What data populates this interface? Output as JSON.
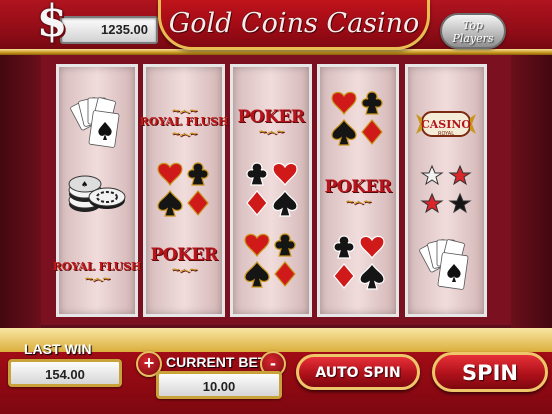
{
  "header": {
    "currency_symbol": "$",
    "balance": "1235.00",
    "title": "Gold Coins Casino",
    "top_players_line1": "Top",
    "top_players_line2": "Players"
  },
  "reels": {
    "poker_text": "POKER",
    "royal_flush_text": "ROYAL FLUSH",
    "casino_badge_text": "CASINO",
    "casino_badge_sub": "ROYAL",
    "columns": [
      [
        "cards-spade-hand-icon",
        "chips-stack-icon",
        "royal-flush-logo"
      ],
      [
        "royal-flush-logo",
        "four-suits-icon",
        "poker-logo"
      ],
      [
        "poker-logo",
        "four-suits-icon",
        "four-suits-icon"
      ],
      [
        "four-suits-icon",
        "poker-logo",
        "four-suits-icon"
      ],
      [
        "casino-badge-icon",
        "stars-icon",
        "cards-spade-hand-icon"
      ]
    ]
  },
  "footer": {
    "last_win_label": "LAST WIN",
    "last_win_value": "154.00",
    "current_bet_label": "CURRENT BET",
    "current_bet_value": "10.00",
    "plus_label": "+",
    "minus_label": "-",
    "auto_spin_label": "AUTO SPIN",
    "spin_label": "SPIN"
  },
  "colors": {
    "primary_red": "#b0141f",
    "gold": "#d9aa34",
    "reel_bg": "#ecd5d5"
  }
}
